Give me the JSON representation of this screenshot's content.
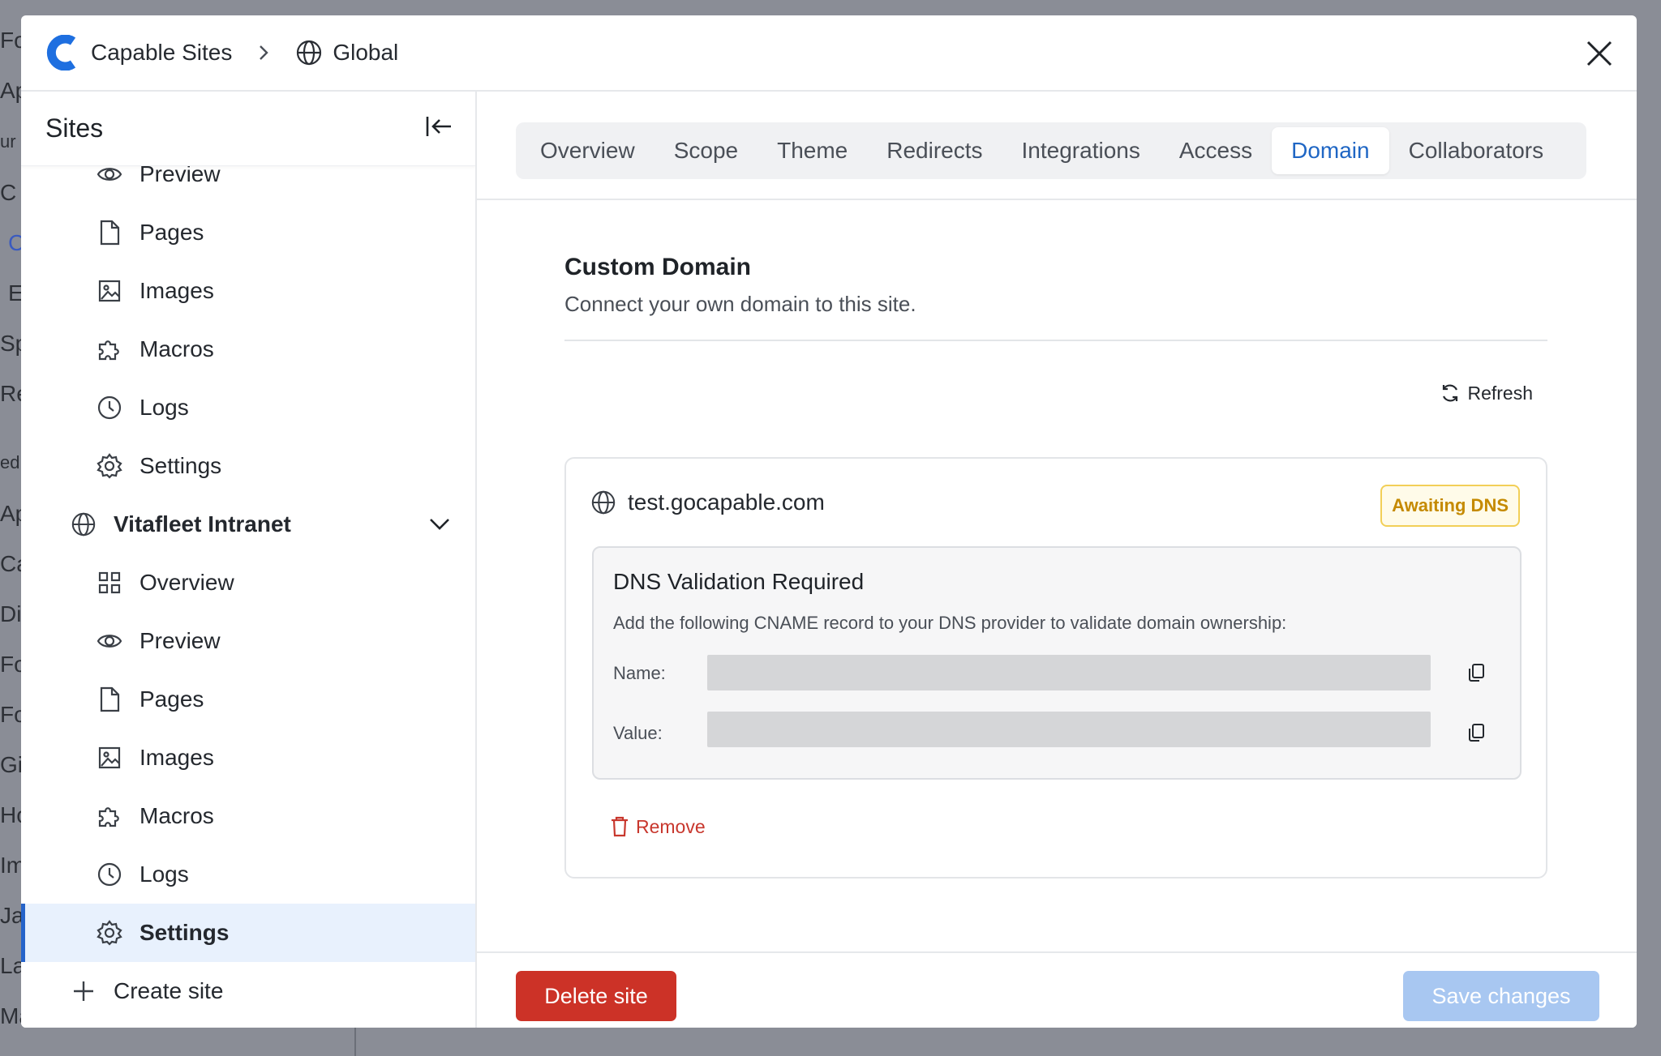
{
  "background": {
    "fragments": [
      "Fo",
      "Ap",
      "ur",
      "C",
      "C",
      "E",
      "Sp",
      "Re",
      "ed",
      "Ap",
      "Ca",
      "Di",
      "Fo",
      "Fo",
      "Gi",
      "Ho",
      "Im",
      "Ja",
      "La",
      "Ma"
    ]
  },
  "header": {
    "brand": "Capable Sites",
    "scope": "Global"
  },
  "sidebar": {
    "title": "Sites",
    "items_top": [
      {
        "label": "Preview",
        "icon": "eye-icon"
      },
      {
        "label": "Pages",
        "icon": "page-icon"
      },
      {
        "label": "Images",
        "icon": "image-icon"
      },
      {
        "label": "Macros",
        "icon": "puzzle-icon"
      },
      {
        "label": "Logs",
        "icon": "clock-icon"
      },
      {
        "label": "Settings",
        "icon": "gear-icon"
      }
    ],
    "site_name": "Vitafleet Intranet",
    "items_site": [
      {
        "label": "Overview",
        "icon": "grid-icon"
      },
      {
        "label": "Preview",
        "icon": "eye-icon"
      },
      {
        "label": "Pages",
        "icon": "page-icon"
      },
      {
        "label": "Images",
        "icon": "image-icon"
      },
      {
        "label": "Macros",
        "icon": "puzzle-icon"
      },
      {
        "label": "Logs",
        "icon": "clock-icon"
      },
      {
        "label": "Settings",
        "icon": "gear-icon"
      }
    ],
    "create_label": "Create site"
  },
  "tabs": [
    "Overview",
    "Scope",
    "Theme",
    "Redirects",
    "Integrations",
    "Access",
    "Domain",
    "Collaborators"
  ],
  "active_tab": "Domain",
  "section": {
    "title": "Custom Domain",
    "subtitle": "Connect your own domain to this site.",
    "refresh_label": "Refresh"
  },
  "domain": {
    "name": "test.gocapable.com",
    "status": "Awaiting DNS",
    "dns_title": "DNS Validation Required",
    "dns_description": "Add the following CNAME record to your DNS provider to validate domain ownership:",
    "name_label": "Name:",
    "value_label": "Value:",
    "remove_label": "Remove"
  },
  "footer": {
    "delete_label": "Delete site",
    "save_label": "Save changes"
  },
  "colors": {
    "accent": "#1f66c4",
    "danger": "#cc3227",
    "warning": "#c58a00",
    "save_disabled": "#a8c7f1"
  }
}
